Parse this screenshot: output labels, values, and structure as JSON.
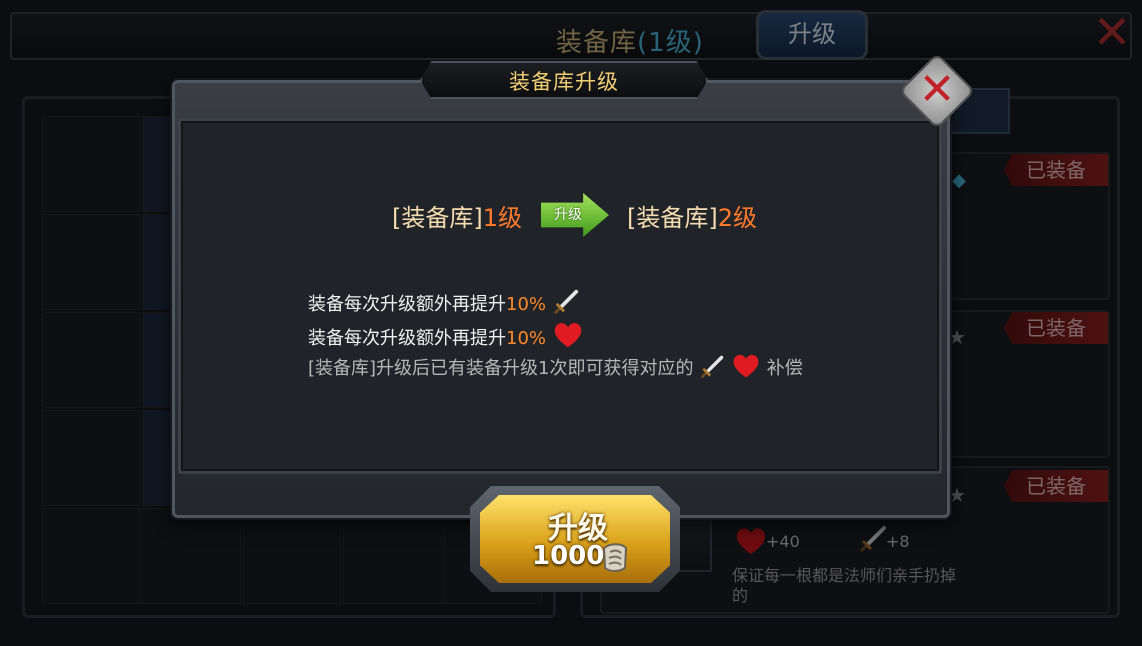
{
  "background": {
    "title": "装备库",
    "title_level": "(1级)",
    "upgrade_button": "升级",
    "equip_tags": [
      "已装备",
      "已装备",
      "已装备"
    ],
    "stats": {
      "hp": "+40",
      "attack": "+8"
    },
    "item_description": "保证每一根都是法师们亲手扔掉的"
  },
  "modal": {
    "title": "装备库升级",
    "from_name": "[装备库]",
    "from_level": "1级",
    "arrow_label": "升级",
    "to_name": "[装备库]",
    "to_level": "2级",
    "line1_text": "装备每次升级额外再提升",
    "line1_pct": "10%",
    "line2_text": "装备每次升级额外再提升",
    "line2_pct": "10%",
    "note_prefix": "[装备库]升级后已有装备升级1次即可获得对应的",
    "note_suffix": "补偿",
    "button_label": "升级",
    "button_cost": "1000"
  },
  "colors": {
    "accent_orange": "#ff7a2a",
    "title_gold": "#f3cf74",
    "button_gold": "#d9a11a",
    "arrow_green": "#5fbf2a",
    "equipped_red": "#8d2020"
  }
}
